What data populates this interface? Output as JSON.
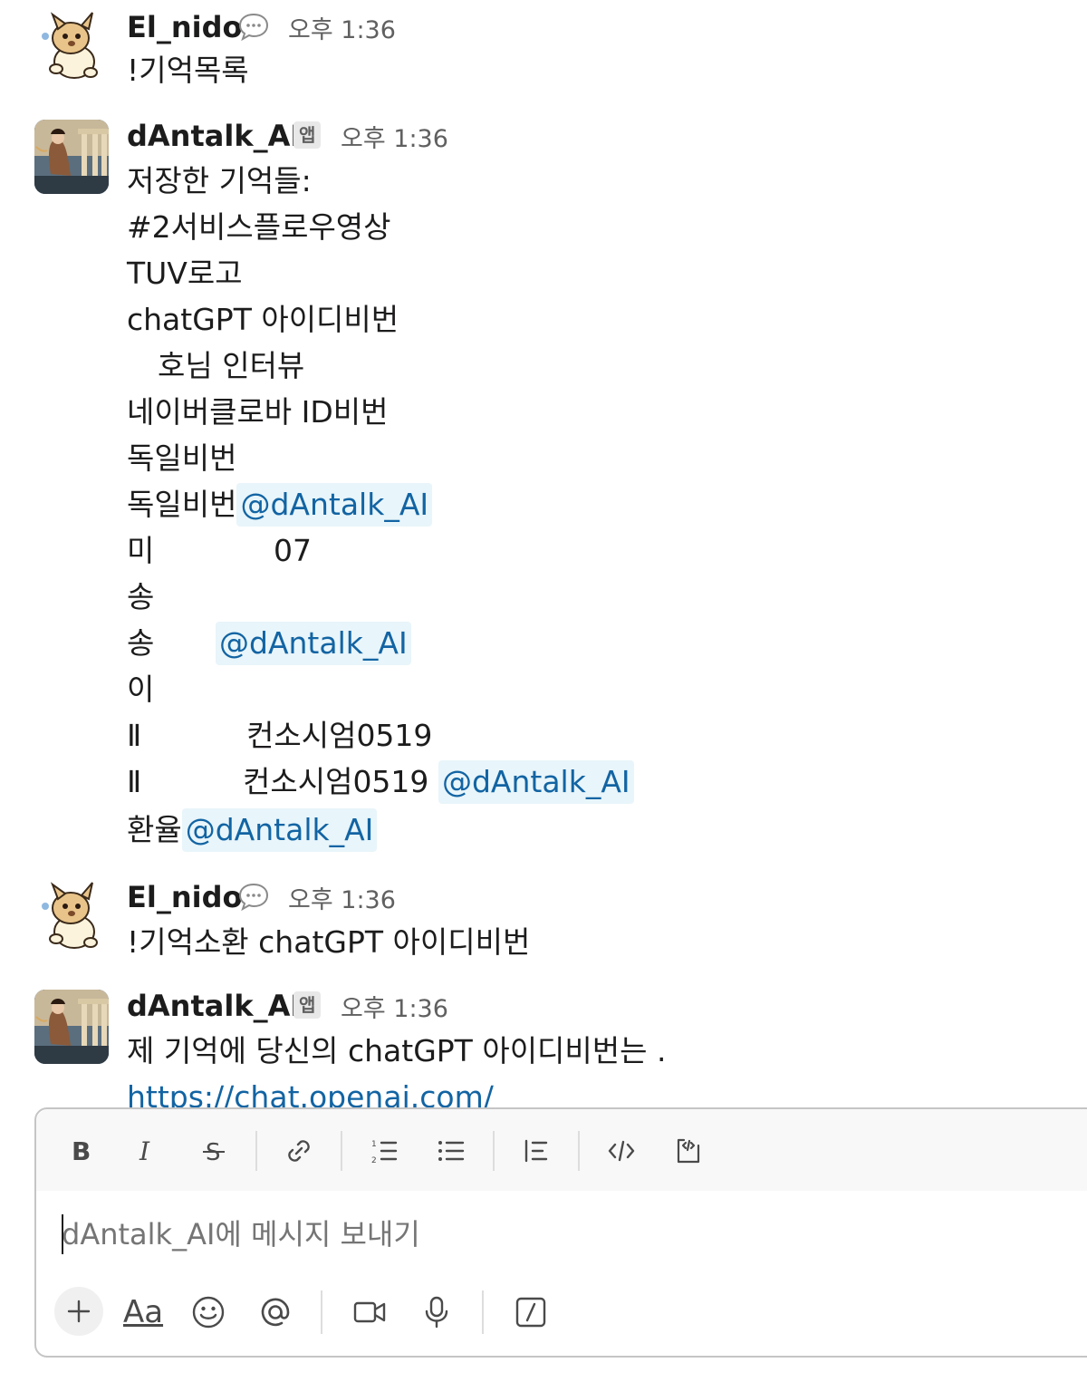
{
  "messages": [
    {
      "author": "El_nido",
      "time": "오후 1:36",
      "lines": [
        "!기억목록"
      ]
    },
    {
      "author": "dAntalk_AI",
      "badge": "앱",
      "time": "오후 1:36",
      "lines": [
        "저장한 기억들:",
        "#2서비스플로우영상",
        "TUV로고",
        "chatGPT 아이디비번",
        "호님 인터뷰",
        "네이버클로바 ID비번",
        "독일비번",
        "독일비번",
        "미",
        "07",
        "송",
        "송",
        "이",
        "Ⅱ",
        "컨소시엄0519",
        "Ⅱ",
        "컨소시엄0519",
        "환율"
      ],
      "mention": "@dAntalk_AI"
    },
    {
      "author": "El_nido",
      "time": "오후 1:36",
      "lines": [
        "!기억소환 chatGPT 아이디비번"
      ]
    },
    {
      "author": "dAntalk_AI",
      "badge": "앱",
      "time": "오후 1:36",
      "lines": [
        "제 기억에 당신의 chatGPT 아이디비번는 ."
      ],
      "link": "https://chat.openai.com/"
    }
  ],
  "composer": {
    "placeholder": "dAntalk_AI에 메시지 보내기",
    "formatting_tools": [
      "bold-icon",
      "italic-icon",
      "strikethrough-icon",
      "link-icon",
      "ordered-list-icon",
      "bulleted-list-icon",
      "blockquote-icon",
      "code-icon",
      "code-block-icon"
    ],
    "bottom_tools": [
      "plus-icon",
      "Aa",
      "emoji-icon",
      "mention-icon",
      "video-icon",
      "microphone-icon",
      "slash-command-icon"
    ],
    "aa_label": "Aa"
  },
  "colors": {
    "mention_bg": "#e8f5fa",
    "mention_text": "#1264a3",
    "link": "#1264a3",
    "timestamp": "#616061"
  }
}
